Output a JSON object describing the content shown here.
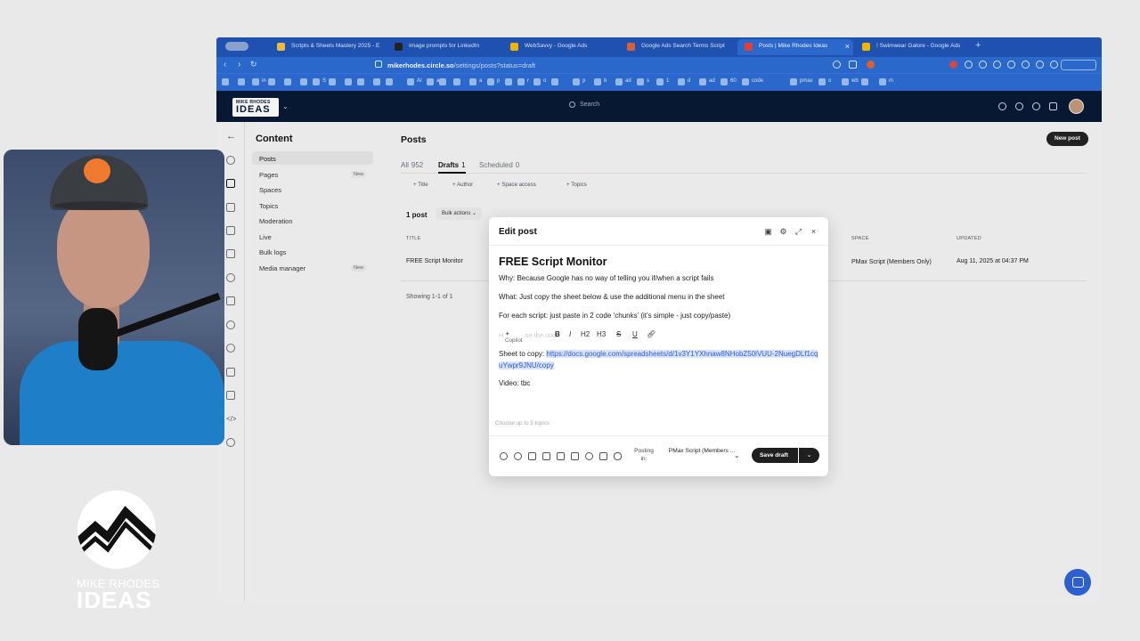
{
  "browser": {
    "tabs": [
      {
        "label": "Scripts & Sheets Mastery 2025 - E",
        "fav": "#f5c342"
      },
      {
        "label": "Image prompts for LinkedIn",
        "fav": "#222222"
      },
      {
        "label": "WebSavvy - Google Ads",
        "fav": "#fbbc04"
      },
      {
        "label": "Google Ads Search Terms Script",
        "fav": "#e0663a"
      },
      {
        "label": "Posts | Mike Rhodes Ideas",
        "fav": "#ea4335"
      },
      {
        "label": "! Swimwear Galore - Google Ads",
        "fav": "#fbbc04"
      }
    ],
    "url_host": "mikerhodes.circle.so",
    "url_path": "/settings/posts?status=draft",
    "bookmarks": [
      "",
      "",
      "in",
      "",
      "",
      "",
      "S",
      "",
      "",
      "",
      "",
      "",
      "AI",
      "a",
      "",
      "",
      "a",
      "p",
      "",
      "r",
      "o",
      "",
      "p",
      "b",
      "ad",
      "s",
      "1",
      "d",
      "ad",
      "60",
      "code",
      "pmax",
      "o",
      "wb",
      "",
      "m"
    ]
  },
  "site": {
    "logo_line1": "MIKE RHODES",
    "logo_line2": "IDEAS",
    "search_placeholder": "Search"
  },
  "nav": {
    "title": "Content",
    "items": [
      {
        "label": "Posts",
        "badge": ""
      },
      {
        "label": "Pages",
        "badge": "New"
      },
      {
        "label": "Spaces",
        "badge": ""
      },
      {
        "label": "Topics",
        "badge": ""
      },
      {
        "label": "Moderation",
        "badge": ""
      },
      {
        "label": "Live",
        "badge": ""
      },
      {
        "label": "Bulk logs",
        "badge": ""
      },
      {
        "label": "Media manager",
        "badge": "New"
      }
    ]
  },
  "posts": {
    "title": "Posts",
    "new_post": "New post",
    "tabs": [
      {
        "label": "All",
        "count": "952"
      },
      {
        "label": "Drafts",
        "count": "1"
      },
      {
        "label": "Scheduled",
        "count": "0"
      }
    ],
    "chips": [
      "Title",
      "Author",
      "Space access",
      "Topics"
    ],
    "count_label": "1 post",
    "bulk_actions": "Bulk actions",
    "columns": {
      "title": "TITLE",
      "space": "SPACE",
      "updated": "UPDATED"
    },
    "row": {
      "title": "FREE Script Monitor",
      "space": "PMax Script (Members Only)",
      "updated": "Aug 11, 2025 at 04:37 PM"
    },
    "showing": "Showing 1-1 of 1"
  },
  "modal": {
    "title": "Edit post",
    "post_title": "FREE Script Monitor",
    "para1": "Why: Because Google has no way of telling you if/when a script fails",
    "para2": "What: Just copy the sheet below & use the additional menu in the sheet",
    "para3": "For each script: just paste in 2 code ‘chunks’ (it’s simple - just copy/paste)",
    "ghost_line": "How to use the code",
    "copilot": "Copilot",
    "format": {
      "bold": "B",
      "italic": "I",
      "h2": "H2",
      "h3": "H3",
      "strike": "S",
      "underline": "U"
    },
    "sheet_prefix": "Sheet to copy: ",
    "sheet_link": "https://docs.google.com/spreadsheets/d/1v3Y1YXhnaw8NHobZ50iVUU-2NuegDLf1cquYwpr9JNU/copy",
    "video_line": "Video: tbc",
    "topics_placeholder": "Choose up to 5 topics",
    "posting_in": "Posting in:",
    "space": "PMax Script (Members ...",
    "save_draft": "Save draft"
  },
  "brand": {
    "line1": "MIKE RHODES",
    "line2": "IDEAS"
  },
  "colors": {
    "tabbar": "#1f55b8",
    "toolbar": "#2b6cd4",
    "site_header": "#061833",
    "link": "#2b5bd7",
    "chat_fab": "#2f64d6"
  }
}
